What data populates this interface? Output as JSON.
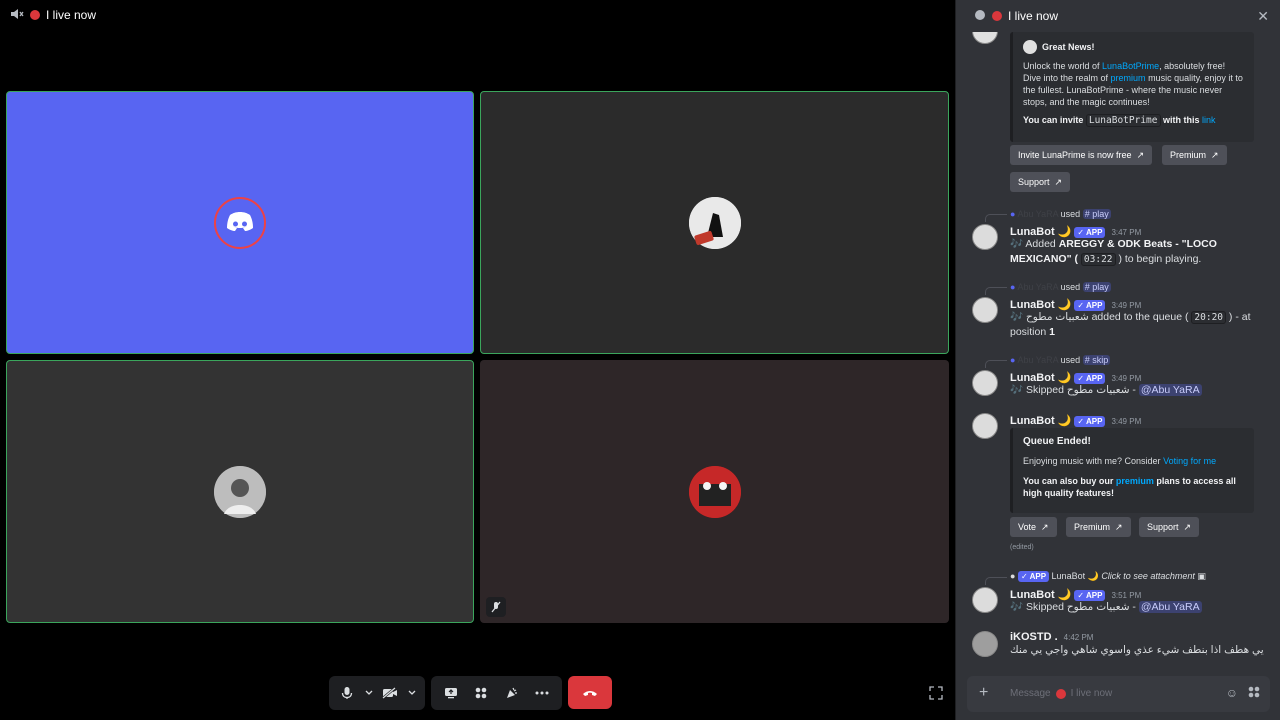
{
  "stage": {
    "title": "I live now",
    "tiles": [
      {
        "bg": "#5865f2"
      },
      {
        "bg": "#2b2b2b"
      },
      {
        "bg": "#333333"
      },
      {
        "bg": "#2e2628"
      }
    ]
  },
  "controls": {
    "mic": "microphone-icon",
    "camera": "camera-off-icon",
    "screenshare": "screenshare-icon",
    "activities": "activities-icon",
    "soundboard": "soundboard-icon",
    "more": "more-icon",
    "hangup": "hangup-icon"
  },
  "chat": {
    "title": "I live now",
    "messages": {
      "embed1": {
        "title": "Great News!",
        "text_a": "Unlock the world of ",
        "link_a": "LunaBotPrime",
        "text_b": ", absolutely free! Dive into the realm of ",
        "link_b": "premium",
        "text_c": " music quality, enjoy it to the fullest. LunaBotPrime - where the music never stops, and the magic continues!",
        "invite_a": "You can invite ",
        "invite_code": "LunaBotPrime",
        "invite_b": " with this ",
        "invite_link": "link",
        "btn1": "Invite LunaPrime is now free",
        "btn2": "Premium",
        "btn3": "Support"
      },
      "m1": {
        "reply_user": "Abu YaRA",
        "reply_used": "used",
        "reply_cmd": "# play",
        "user": "LunaBot 🌙",
        "app": "✓ APP",
        "time": "3:47 PM",
        "text_a": "🎶 Added ",
        "bold": "AREGGY & ODK Beats - \"LOCO MEXICANO\"",
        "text_b": " ( ",
        "code": "03:22",
        "text_c": " ) to begin playing."
      },
      "m2": {
        "reply_user": "Abu YaRA",
        "reply_used": "used",
        "reply_cmd": "# play",
        "user": "LunaBot 🌙",
        "app": "✓ APP",
        "time": "3:49 PM",
        "text_a": "🎶 شعبيات مطوح",
        "text_b": " added to the queue ( ",
        "code": "20:20",
        "text_c": " ) - at position ",
        "pos": "1"
      },
      "m3": {
        "reply_user": "Abu YaRA",
        "reply_used": "used",
        "reply_cmd": "# skip",
        "user": "LunaBot 🌙",
        "app": "✓ APP",
        "time": "3:49 PM",
        "text_a": "🎶 Skipped شعبيات مطوح - ",
        "mention": "@Abu YaRA"
      },
      "m4": {
        "user": "LunaBot 🌙",
        "app": "✓ APP",
        "time": "3:49 PM",
        "embed_title": "Queue Ended!",
        "embed_a": "Enjoying music with me? Consider ",
        "embed_link": "Voting for me",
        "embed_b1": "You can also buy our ",
        "embed_b_link": "premium",
        "embed_b2": " plans to access all high quality features!",
        "btn1": "Vote",
        "btn2": "Premium",
        "btn3": "Support",
        "edited": "(edited)"
      },
      "m5": {
        "reply_app": "✓ APP",
        "reply_user": "LunaBot 🌙",
        "reply_text": "Click to see attachment",
        "user": "LunaBot 🌙",
        "app": "✓ APP",
        "time": "3:51 PM",
        "text_a": "🎶 Skipped شعبيات مطوح - ",
        "mention": "@Abu YaRA"
      },
      "m6": {
        "user": "iKOSTD .",
        "time": "4:42 PM",
        "text": "يي هطف اذا بنطف شيء عذي واسوي شاهي واجي يي منك"
      }
    },
    "composer": {
      "placeholder_a": "Message",
      "placeholder_b": "I live now"
    }
  },
  "colors": {
    "accent": "#5865f2",
    "hangup": "#da373c",
    "speaking": "#3ba55c",
    "link": "#00a8fc"
  }
}
